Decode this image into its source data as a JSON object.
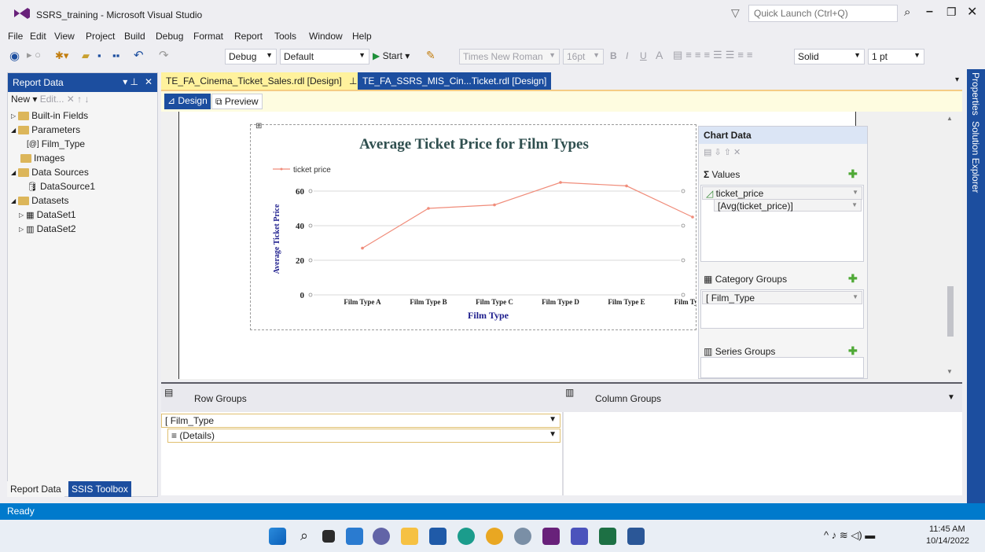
{
  "window": {
    "title": "SSRS_training - Microsoft Visual Studio",
    "quick_launch_placeholder": "Quick Launch (Ctrl+Q)"
  },
  "menu": [
    "File",
    "Edit",
    "View",
    "Project",
    "Build",
    "Debug",
    "Format",
    "Report",
    "Tools",
    "Window",
    "Help"
  ],
  "toolbar": {
    "config": "Debug",
    "platform": "Default",
    "start": "Start",
    "font": "Times New Roman",
    "size": "16pt",
    "bold": "B",
    "italic": "I",
    "underline": "U",
    "border_style": "Solid",
    "border_width": "1 pt"
  },
  "report_data": {
    "title": "Report Data",
    "new_label": "New",
    "edit_label": "Edit...",
    "tree": {
      "builtin": "Built-in Fields",
      "parameters": "Parameters",
      "param_film_type": "Film_Type",
      "images": "Images",
      "data_sources": "Data Sources",
      "datasource1": "DataSource1",
      "datasets": "Datasets",
      "dataset1": "DataSet1",
      "dataset2": "DataSet2"
    },
    "tabs": [
      "Report Data",
      "SSIS Toolbox"
    ]
  },
  "doc_tabs": [
    "TE_FA_Cinema_Ticket_Sales.rdl [Design]",
    "TE_FA_SSRS_MIS_Cin...Ticket.rdl [Design]"
  ],
  "view_tabs": [
    "Design",
    "Preview"
  ],
  "chart_data": {
    "type": "line",
    "title": "Average Ticket Price for Film Types",
    "xlabel": "Film Type",
    "ylabel": "Average Ticket Price",
    "categories": [
      "Film Type A",
      "Film Type B",
      "Film Type C",
      "Film Type D",
      "Film Type E",
      "Film Type F"
    ],
    "series": [
      {
        "name": "ticket price",
        "values": [
          27,
          50,
          52,
          65,
          63,
          45
        ]
      }
    ],
    "yticks": [
      "0",
      "20",
      "40",
      "60"
    ],
    "ylim": [
      0,
      70
    ],
    "grid": true,
    "legend": "top-left",
    "color": "#f08c7a"
  },
  "chart_data_panel": {
    "title": "Chart Data",
    "values_label": "Values",
    "value_field": "ticket_price",
    "value_expr": "[Avg(ticket_price)]",
    "category_label": "Category Groups",
    "category_field": "Film_Type",
    "series_label": "Series Groups"
  },
  "groups": {
    "row_label": "Row Groups",
    "column_label": "Column Groups",
    "row_items": [
      "Film_Type",
      "(Details)"
    ]
  },
  "side_tabs": [
    "Properties",
    "Solution Explorer"
  ],
  "status": "Ready",
  "clock": {
    "time": "11:45 AM",
    "date": "10/14/2022"
  }
}
